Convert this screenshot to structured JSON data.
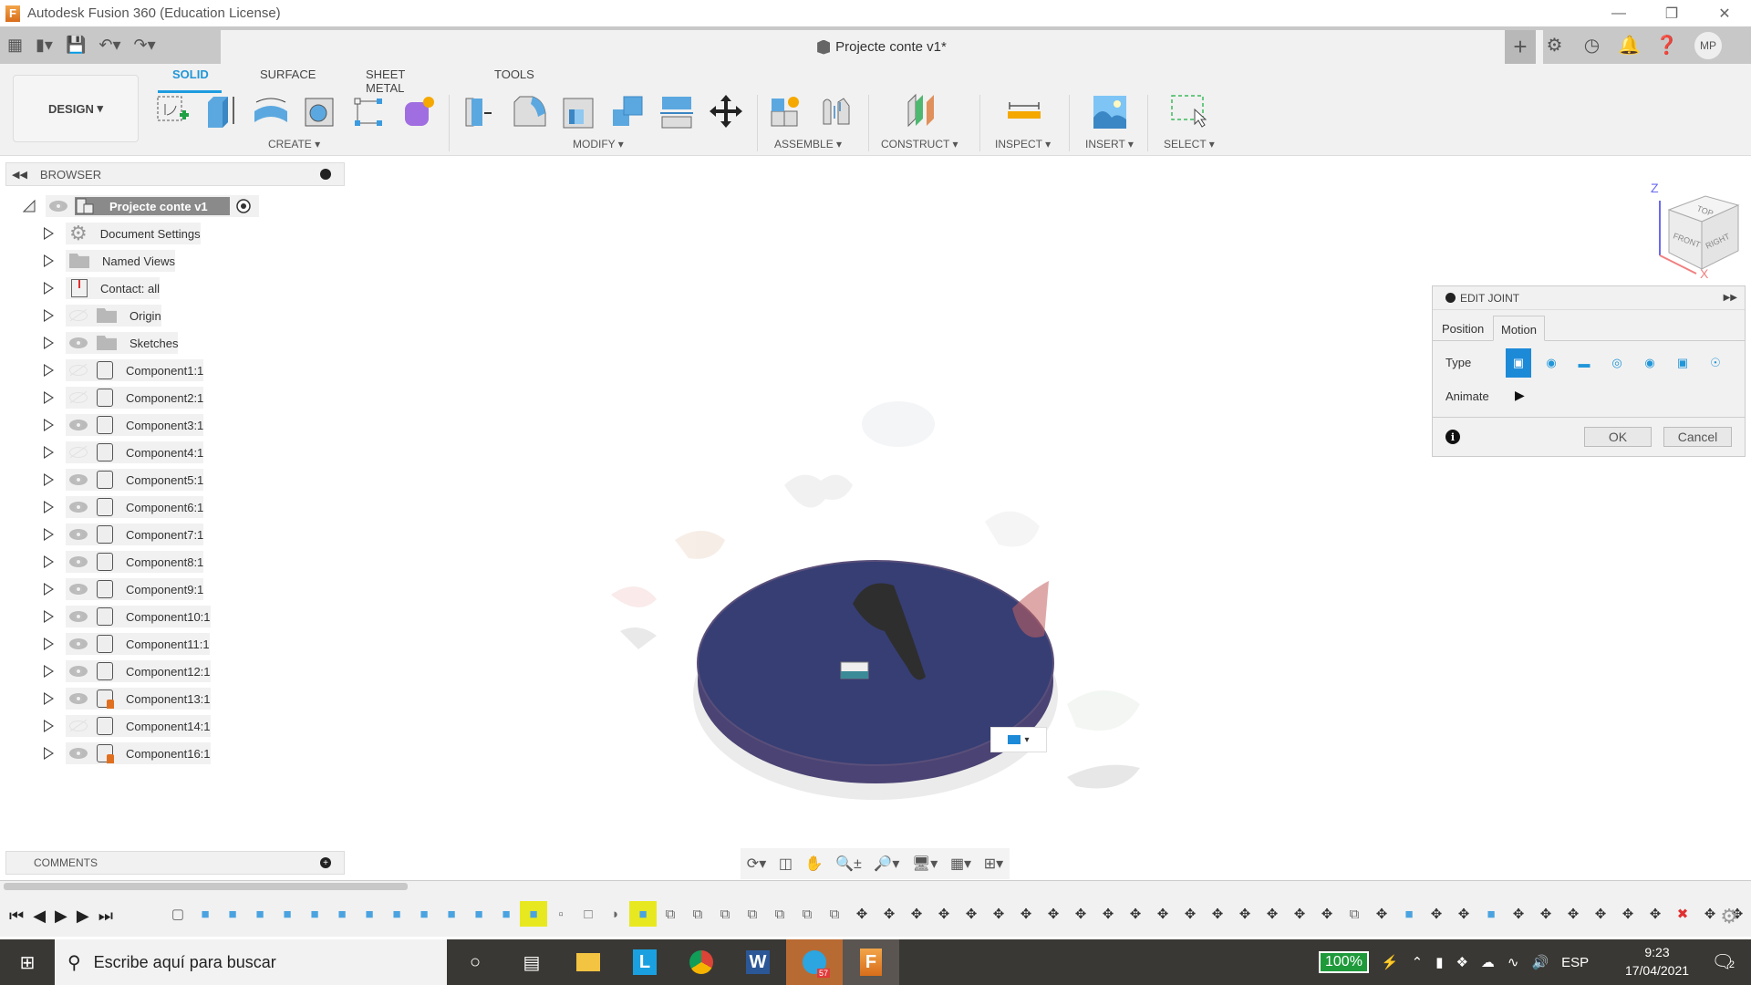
{
  "window": {
    "app_title": "Autodesk Fusion 360 (Education License)",
    "controls": [
      "minimize",
      "restore",
      "close"
    ]
  },
  "tabbar": {
    "document_title": "Projecte conte v1*",
    "user_initials": "MP",
    "icons": [
      "data-panel-icon",
      "file-icon",
      "save-icon",
      "undo-icon",
      "redo-icon",
      "new-tab-icon",
      "extensions-icon",
      "job-status-icon",
      "notifications-icon",
      "help-icon"
    ]
  },
  "toolbar": {
    "workspace": "DESIGN",
    "tabs": [
      {
        "label": "SOLID",
        "active": true
      },
      {
        "label": "SURFACE",
        "active": false
      },
      {
        "label": "SHEET METAL",
        "active": false
      },
      {
        "label": "TOOLS",
        "active": false
      }
    ],
    "groups": [
      {
        "label": "CREATE",
        "tools": [
          "create-sketch",
          "extrude",
          "revolve",
          "hole",
          "pattern",
          "create-form"
        ]
      },
      {
        "label": "MODIFY",
        "tools": [
          "press-pull",
          "fillet",
          "shell",
          "combine",
          "offset-plane-split",
          "move-copy"
        ]
      },
      {
        "label": "ASSEMBLE",
        "tools": [
          "new-component",
          "joint"
        ]
      },
      {
        "label": "CONSTRUCT",
        "tools": [
          "offset-plane"
        ]
      },
      {
        "label": "INSPECT",
        "tools": [
          "measure"
        ]
      },
      {
        "label": "INSERT",
        "tools": [
          "insert-canvas"
        ]
      },
      {
        "label": "SELECT",
        "tools": [
          "window-select"
        ]
      }
    ]
  },
  "browser": {
    "title": "BROWSER",
    "root": "Projecte conte v1",
    "items": [
      {
        "label": "Document Settings",
        "icon": "gear",
        "eye": "none"
      },
      {
        "label": "Named Views",
        "icon": "folder",
        "eye": "none"
      },
      {
        "label": "Contact: all",
        "icon": "contact",
        "eye": "none"
      },
      {
        "label": "Origin",
        "icon": "folder",
        "eye": "hidden"
      },
      {
        "label": "Sketches",
        "icon": "folder",
        "eye": "visible"
      },
      {
        "label": "Component1:1",
        "icon": "component",
        "eye": "hidden"
      },
      {
        "label": "Component2:1",
        "icon": "component",
        "eye": "hidden"
      },
      {
        "label": "Component3:1",
        "icon": "component",
        "eye": "visible"
      },
      {
        "label": "Component4:1",
        "icon": "component",
        "eye": "hidden"
      },
      {
        "label": "Component5:1",
        "icon": "component",
        "eye": "visible"
      },
      {
        "label": "Component6:1",
        "icon": "component",
        "eye": "visible"
      },
      {
        "label": "Component7:1",
        "icon": "component",
        "eye": "visible"
      },
      {
        "label": "Component8:1",
        "icon": "component",
        "eye": "visible"
      },
      {
        "label": "Component9:1",
        "icon": "component",
        "eye": "visible"
      },
      {
        "label": "Component10:1",
        "icon": "component",
        "eye": "visible"
      },
      {
        "label": "Component11:1",
        "icon": "component",
        "eye": "visible"
      },
      {
        "label": "Component12:1",
        "icon": "component",
        "eye": "visible"
      },
      {
        "label": "Component13:1",
        "icon": "component-grounded",
        "eye": "visible"
      },
      {
        "label": "Component14:1",
        "icon": "component",
        "eye": "hidden"
      },
      {
        "label": "Component16:1",
        "icon": "component-grounded",
        "eye": "visible"
      }
    ]
  },
  "comments": {
    "title": "COMMENTS"
  },
  "viewcube": {
    "top": "TOP",
    "front": "FRONT",
    "right": "RIGHT",
    "axis_z": "Z",
    "axis_x": "X"
  },
  "edit_joint": {
    "title": "EDIT JOINT",
    "tabs": [
      {
        "label": "Position",
        "active": false
      },
      {
        "label": "Motion",
        "active": true
      }
    ],
    "type_label": "Type",
    "types": [
      "rigid",
      "revolute",
      "slider",
      "cylindrical",
      "pin-slot",
      "planar",
      "ball"
    ],
    "selected_type": "rigid",
    "animate_label": "Animate",
    "ok_label": "OK",
    "cancel_label": "Cancel"
  },
  "navbar": {
    "tools": [
      "orbit",
      "look-at",
      "pan",
      "zoom",
      "fit",
      "display-settings",
      "grid-snaps",
      "viewports"
    ]
  },
  "timeline": {
    "controls": [
      "first",
      "previous",
      "play",
      "next",
      "last"
    ],
    "items": [
      "sketch",
      "extrude",
      "extrude",
      "extrude",
      "extrude",
      "extrude",
      "extrude",
      "extrude",
      "extrude",
      "extrude",
      "extrude",
      "extrude",
      "extrude",
      "extrude-hl",
      "pattern",
      "box",
      "fillet",
      "extrude-hl",
      "plane",
      "plane",
      "plane",
      "plane",
      "plane",
      "plane",
      "plane",
      "move",
      "move",
      "move",
      "move",
      "move",
      "move",
      "move",
      "move",
      "move",
      "move",
      "move",
      "move",
      "move",
      "move",
      "move",
      "move",
      "move",
      "move",
      "plane",
      "move",
      "extrude",
      "move",
      "move",
      "extrude",
      "move",
      "move",
      "move",
      "move",
      "move",
      "move",
      "joint-error",
      "move",
      "move",
      "move"
    ]
  },
  "taskbar": {
    "search_placeholder": "Escribe aquí para buscar",
    "apps": [
      "cortana",
      "task-view",
      "file-explorer",
      "app-l",
      "chrome",
      "word",
      "telegram",
      "fusion360"
    ],
    "telegram_badge": "57",
    "battery": "100%",
    "language": "ESP",
    "time": "9:23",
    "date": "17/04/2021",
    "notifications_count": "2"
  }
}
